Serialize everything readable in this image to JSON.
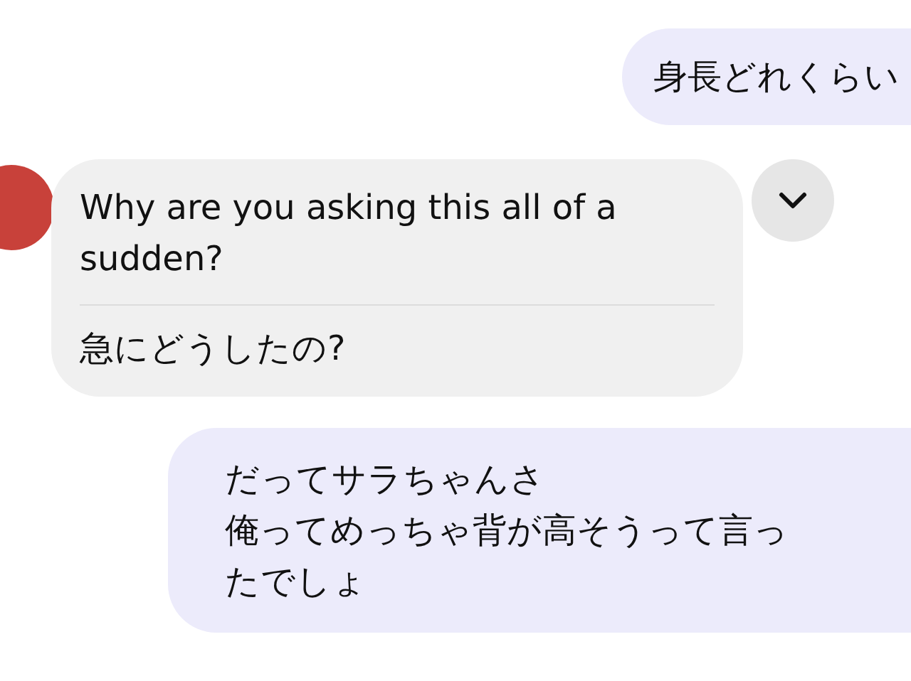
{
  "messages": [
    {
      "kind": "outgoing",
      "lines": [
        "身長どれくらい"
      ]
    },
    {
      "kind": "incoming",
      "original": [
        "Why are you asking this all of a",
        "sudden?"
      ],
      "translation": "急にどうしたの?",
      "translation_expanded": true
    },
    {
      "kind": "outgoing",
      "lines": [
        "だってサラちゃんさ",
        "俺ってめっちゃ背が高そうって言っ",
        "たでしょ"
      ]
    }
  ]
}
